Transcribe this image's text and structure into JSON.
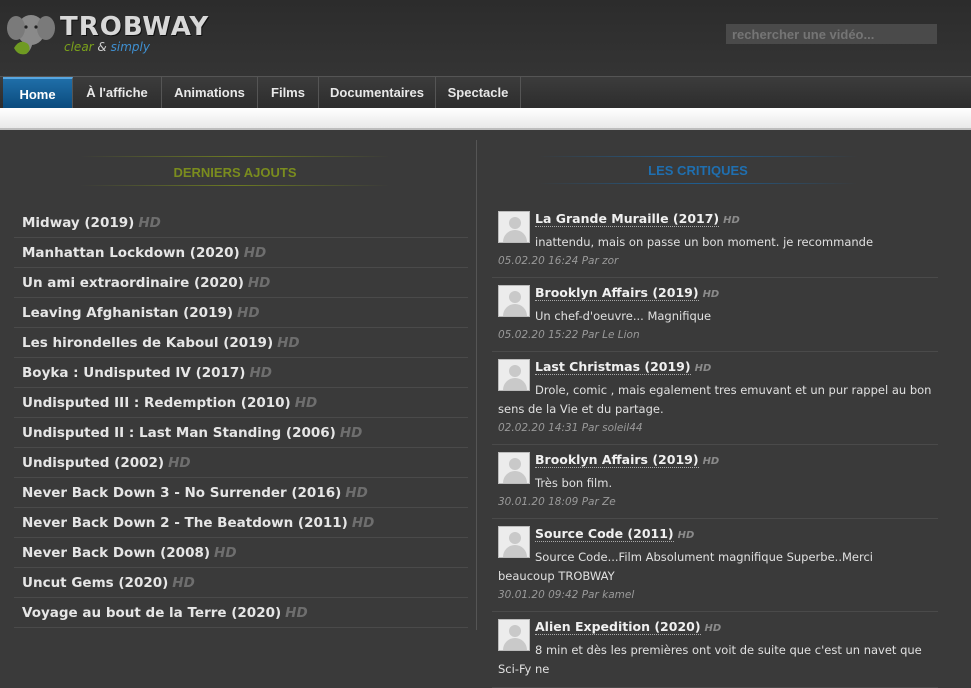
{
  "header": {
    "brand": "TROBWAY",
    "tagline_a": "clear",
    "tagline_b": " & ",
    "tagline_c": "simply",
    "search_placeholder": "rechercher une vidéo..."
  },
  "nav": {
    "items": [
      "Home",
      "À l'affiche",
      "Animations",
      "Films",
      "Documentaires",
      "Spectacle"
    ],
    "active": "Home"
  },
  "latest": {
    "title": "DERNIERS AJOUTS",
    "title_color": "#7a8c1e",
    "hd_label": "HD",
    "items": [
      "Midway (2019)",
      "Manhattan Lockdown (2020)",
      "Un ami extraordinaire (2020)",
      "Leaving Afghanistan (2019)",
      "Les hirondelles de Kaboul (2019)",
      "Boyka : Undisputed IV (2017)",
      "Undisputed III : Redemption (2010)",
      "Undisputed II : Last Man Standing (2006)",
      "Undisputed (2002)",
      "Never Back Down 3 - No Surrender (2016)",
      "Never Back Down 2 - The Beatdown (2011)",
      "Never Back Down (2008)",
      "Uncut Gems (2020)",
      "Voyage au bout de la Terre (2020)"
    ]
  },
  "reviews": {
    "title": "LES CRITIQUES",
    "title_color": "#1f6fb0",
    "hd_label": "HD",
    "items": [
      {
        "title": "La Grande Muraille (2017)",
        "text": "inattendu, mais on passe un bon moment. je recommande",
        "meta": "05.02.20 16:24 Par zor"
      },
      {
        "title": "Brooklyn Affairs (2019)",
        "text": "Un chef-d'oeuvre... Magnifique",
        "meta": "05.02.20 15:22 Par Le Lion"
      },
      {
        "title": "Last Christmas (2019)",
        "text": "Drole, comic , mais egalement tres emuvant et un pur rappel au bon sens de la Vie et du partage.",
        "meta": "02.02.20 14:31 Par soleil44"
      },
      {
        "title": "Brooklyn Affairs (2019)",
        "text": "Très bon film.",
        "meta": "30.01.20 18:09 Par Ze"
      },
      {
        "title": "Source Code (2011)",
        "text": "Source Code...Film Absolument magnifique Superbe..Merci beaucoup TROBWAY",
        "meta": "30.01.20 09:42 Par kamel"
      },
      {
        "title": "Alien Expedition (2020)",
        "text": "8 min et dès les premières ont voit de suite que c'est un navet que Sci-Fy ne",
        "meta": ""
      }
    ]
  }
}
